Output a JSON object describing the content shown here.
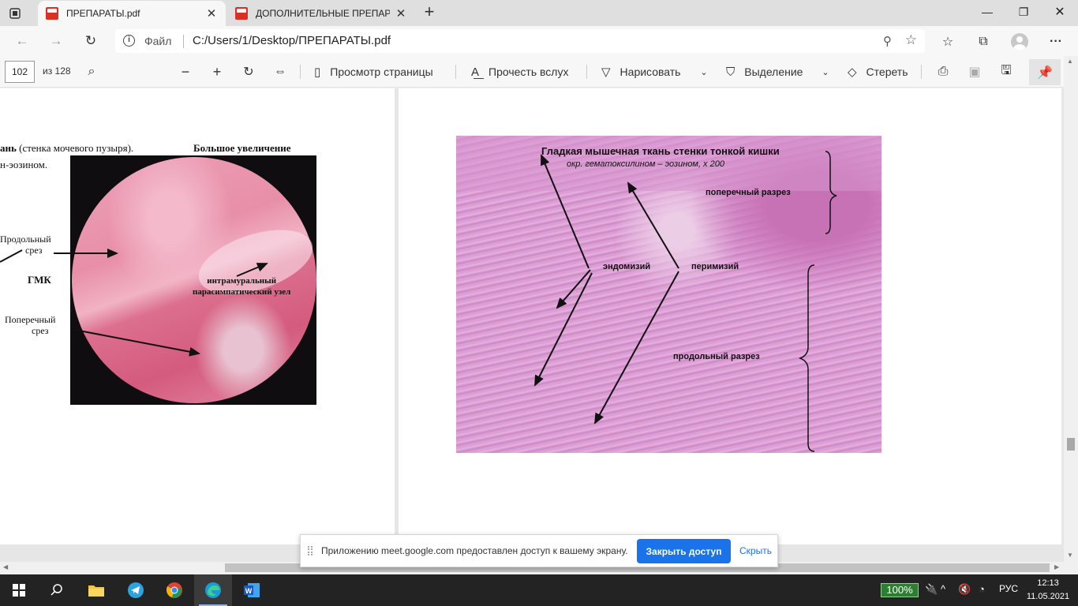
{
  "tabs": [
    {
      "label": "ПРЕПАРАТЫ.pdf",
      "active": true
    },
    {
      "label": "ДОПОЛНИТЕЛЬНЫЕ ПРЕПАРАТЫ",
      "active": false
    }
  ],
  "address": {
    "scheme_label": "Файл",
    "url": "C:/Users/1/Desktop/ПРЕПАРАТЫ.pdf"
  },
  "pdf_toolbar": {
    "page_current": "102",
    "page_total": "из 128",
    "page_view": "Просмотр страницы",
    "read_aloud": "Прочесть вслух",
    "draw": "Нарисовать",
    "highlight": "Выделение",
    "erase": "Стереть"
  },
  "page_left": {
    "heading_bold": "ань",
    "heading_rest": "(стенка мочевого пузыря).",
    "magnification": "Большое увеличение",
    "stain": "н-эозином.",
    "label_longitudinal_1": "Продольный",
    "label_longitudinal_2": "срез",
    "label_smc": "ГМК",
    "label_ganglion_1": "интрамуральный",
    "label_ganglion_2": "парасимпатический узел",
    "label_cross_1": "Поперечный",
    "label_cross_2": "срез"
  },
  "page_right": {
    "title": "Гладкая мышечная ткань стенки тонкой кишки",
    "subtitle": "окр. гематоксилином – эозином, х 200",
    "label_cross": "поперечный разрез",
    "label_endomysium": "эндомизий",
    "label_perimysium": "перимизий",
    "label_longitudinal": "продольный разрез"
  },
  "notice": {
    "message": "Приложению meet.google.com предоставлен доступ к вашему экрану.",
    "stop_button": "Закрыть доступ",
    "hide_link": "Скрыть"
  },
  "taskbar": {
    "battery": "100%",
    "language": "РУС",
    "time": "12:13",
    "date": "11.05.2021"
  }
}
